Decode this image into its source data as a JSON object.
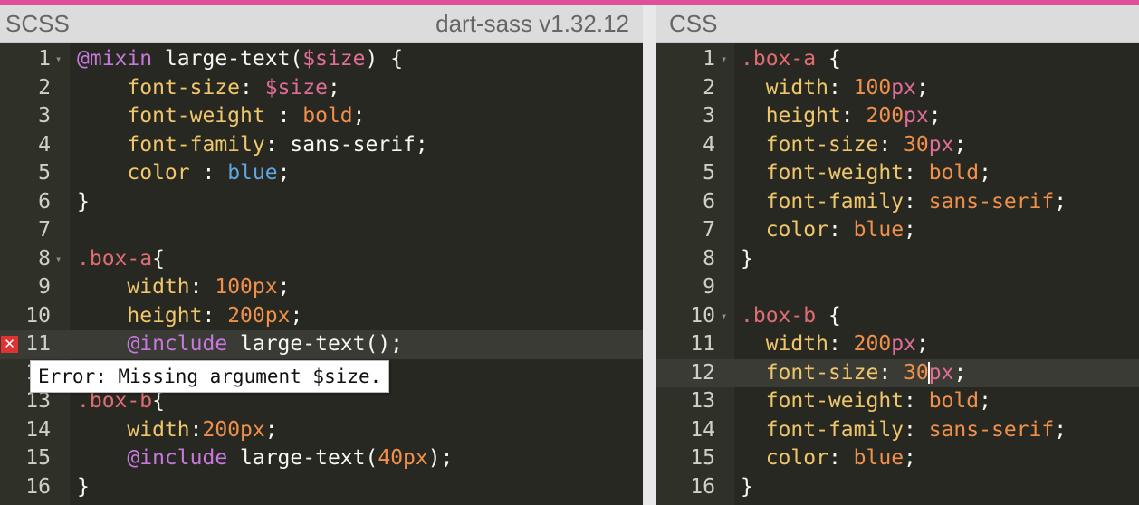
{
  "left_pane": {
    "title": "SCSS",
    "version": "dart-sass v1.32.12",
    "lines": [
      {
        "n": "1",
        "fold": true,
        "tokens": [
          [
            "kw",
            "@mixin"
          ],
          [
            "plain",
            " large-text("
          ],
          [
            "var",
            "$size"
          ],
          [
            "plain",
            ") {"
          ]
        ]
      },
      {
        "n": "2",
        "tokens": [
          [
            "plain",
            "    "
          ],
          [
            "prop",
            "font-size"
          ],
          [
            "plain",
            ": "
          ],
          [
            "var",
            "$size"
          ],
          [
            "plain",
            ";"
          ]
        ]
      },
      {
        "n": "3",
        "tokens": [
          [
            "plain",
            "    "
          ],
          [
            "prop",
            "font-weight"
          ],
          [
            "plain",
            " : "
          ],
          [
            "str",
            "bold"
          ],
          [
            "plain",
            ";"
          ]
        ]
      },
      {
        "n": "4",
        "tokens": [
          [
            "plain",
            "    "
          ],
          [
            "prop",
            "font-family"
          ],
          [
            "plain",
            ": "
          ],
          [
            "plain",
            "sans-serif"
          ],
          [
            "plain",
            ";"
          ]
        ]
      },
      {
        "n": "5",
        "tokens": [
          [
            "plain",
            "    "
          ],
          [
            "prop",
            "color"
          ],
          [
            "plain",
            " : "
          ],
          [
            "blue",
            "blue"
          ],
          [
            "plain",
            ";"
          ]
        ]
      },
      {
        "n": "6",
        "tokens": [
          [
            "plain",
            "}"
          ]
        ]
      },
      {
        "n": "7",
        "tokens": []
      },
      {
        "n": "8",
        "fold": true,
        "tokens": [
          [
            "sel",
            ".box-a"
          ],
          [
            "plain",
            "{"
          ]
        ]
      },
      {
        "n": "9",
        "tokens": [
          [
            "plain",
            "    "
          ],
          [
            "prop",
            "width"
          ],
          [
            "plain",
            ": "
          ],
          [
            "num",
            "100"
          ],
          [
            "num",
            "px"
          ],
          [
            "plain",
            ";"
          ]
        ]
      },
      {
        "n": "10",
        "tokens": [
          [
            "plain",
            "    "
          ],
          [
            "prop",
            "height"
          ],
          [
            "plain",
            ": "
          ],
          [
            "num",
            "200"
          ],
          [
            "num",
            "px"
          ],
          [
            "plain",
            ";"
          ]
        ]
      },
      {
        "n": "11",
        "error": true,
        "active": true,
        "tokens": [
          [
            "plain",
            "    "
          ],
          [
            "kw",
            "@include"
          ],
          [
            "plain",
            " large-text();"
          ]
        ]
      },
      {
        "n": "12",
        "tokens": []
      },
      {
        "n": "13",
        "tokens": [
          [
            "sel",
            ".box-b"
          ],
          [
            "plain",
            "{"
          ]
        ]
      },
      {
        "n": "14",
        "tokens": [
          [
            "plain",
            "    "
          ],
          [
            "prop",
            "width"
          ],
          [
            "plain",
            ":"
          ],
          [
            "num",
            "200"
          ],
          [
            "num",
            "px"
          ],
          [
            "plain",
            ";"
          ]
        ]
      },
      {
        "n": "15",
        "tokens": [
          [
            "plain",
            "    "
          ],
          [
            "kw",
            "@include"
          ],
          [
            "plain",
            " large-text("
          ],
          [
            "num",
            "40"
          ],
          [
            "num",
            "px"
          ],
          [
            "plain",
            ");"
          ]
        ]
      },
      {
        "n": "16",
        "tokens": [
          [
            "plain",
            "}"
          ]
        ]
      }
    ],
    "error_tooltip": "Error: Missing argument $size."
  },
  "right_pane": {
    "title": "CSS",
    "lines": [
      {
        "n": "1",
        "fold": true,
        "tokens": [
          [
            "sel",
            ".box-a"
          ],
          [
            "plain",
            " {"
          ]
        ]
      },
      {
        "n": "2",
        "tokens": [
          [
            "plain",
            "  "
          ],
          [
            "prop",
            "width"
          ],
          [
            "plain",
            ": "
          ],
          [
            "num",
            "100"
          ],
          [
            "unit",
            "px"
          ],
          [
            "plain",
            ";"
          ]
        ]
      },
      {
        "n": "3",
        "tokens": [
          [
            "plain",
            "  "
          ],
          [
            "prop",
            "height"
          ],
          [
            "plain",
            ": "
          ],
          [
            "num",
            "200"
          ],
          [
            "unit",
            "px"
          ],
          [
            "plain",
            ";"
          ]
        ]
      },
      {
        "n": "4",
        "tokens": [
          [
            "plain",
            "  "
          ],
          [
            "prop",
            "font-size"
          ],
          [
            "plain",
            ": "
          ],
          [
            "num",
            "30"
          ],
          [
            "unit",
            "px"
          ],
          [
            "plain",
            ";"
          ]
        ]
      },
      {
        "n": "5",
        "tokens": [
          [
            "plain",
            "  "
          ],
          [
            "prop",
            "font-weight"
          ],
          [
            "plain",
            ": "
          ],
          [
            "str",
            "bold"
          ],
          [
            "plain",
            ";"
          ]
        ]
      },
      {
        "n": "6",
        "tokens": [
          [
            "plain",
            "  "
          ],
          [
            "prop",
            "font-family"
          ],
          [
            "plain",
            ": "
          ],
          [
            "str",
            "sans-serif"
          ],
          [
            "plain",
            ";"
          ]
        ]
      },
      {
        "n": "7",
        "tokens": [
          [
            "plain",
            "  "
          ],
          [
            "prop",
            "color"
          ],
          [
            "plain",
            ": "
          ],
          [
            "str",
            "blue"
          ],
          [
            "plain",
            ";"
          ]
        ]
      },
      {
        "n": "8",
        "tokens": [
          [
            "plain",
            "}"
          ]
        ]
      },
      {
        "n": "9",
        "tokens": []
      },
      {
        "n": "10",
        "fold": true,
        "tokens": [
          [
            "sel",
            ".box-b"
          ],
          [
            "plain",
            " {"
          ]
        ]
      },
      {
        "n": "11",
        "tokens": [
          [
            "plain",
            "  "
          ],
          [
            "prop",
            "width"
          ],
          [
            "plain",
            ": "
          ],
          [
            "num",
            "200"
          ],
          [
            "unit",
            "px"
          ],
          [
            "plain",
            ";"
          ]
        ]
      },
      {
        "n": "12",
        "active": true,
        "cursor_after_token": 4,
        "tokens": [
          [
            "plain",
            "  "
          ],
          [
            "prop",
            "font-size"
          ],
          [
            "plain",
            ": "
          ],
          [
            "num",
            "30"
          ],
          [
            "unit",
            "px"
          ],
          [
            "plain",
            ";"
          ]
        ]
      },
      {
        "n": "13",
        "tokens": [
          [
            "plain",
            "  "
          ],
          [
            "prop",
            "font-weight"
          ],
          [
            "plain",
            ": "
          ],
          [
            "str",
            "bold"
          ],
          [
            "plain",
            ";"
          ]
        ]
      },
      {
        "n": "14",
        "tokens": [
          [
            "plain",
            "  "
          ],
          [
            "prop",
            "font-family"
          ],
          [
            "plain",
            ": "
          ],
          [
            "str",
            "sans-serif"
          ],
          [
            "plain",
            ";"
          ]
        ]
      },
      {
        "n": "15",
        "tokens": [
          [
            "plain",
            "  "
          ],
          [
            "prop",
            "color"
          ],
          [
            "plain",
            ": "
          ],
          [
            "str",
            "blue"
          ],
          [
            "plain",
            ";"
          ]
        ]
      },
      {
        "n": "16",
        "tokens": [
          [
            "plain",
            "}"
          ]
        ]
      }
    ]
  },
  "icons": {
    "fold": "▾",
    "error": "✕"
  },
  "colors": {
    "accent": "#e0509a",
    "editor_bg": "#272822",
    "error": "#dd3333"
  }
}
